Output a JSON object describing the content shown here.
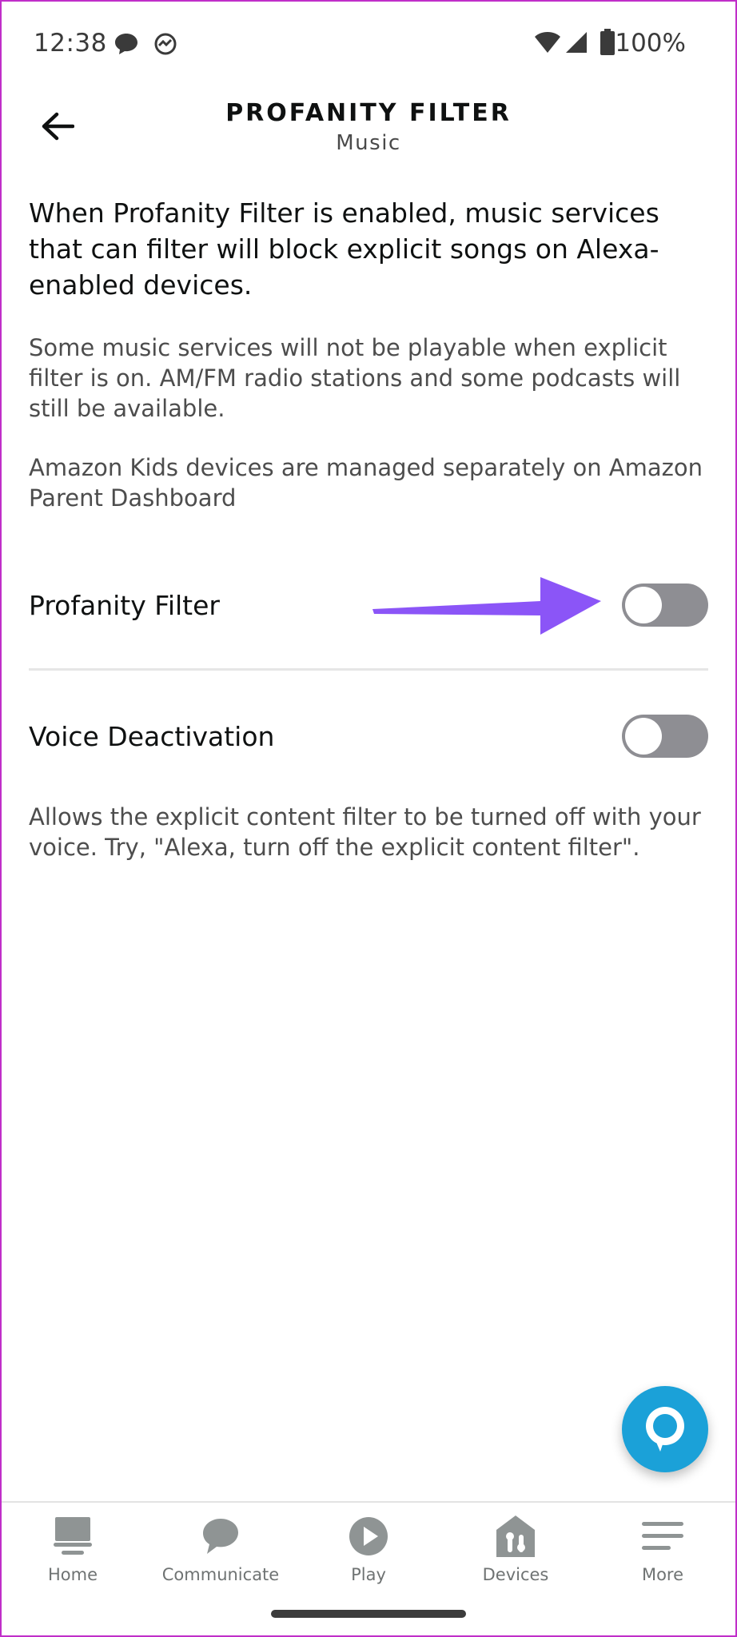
{
  "status_bar": {
    "time": "12:38",
    "battery": "100%",
    "icons": [
      "chat-bubble-icon",
      "activity-icon",
      "wifi-icon",
      "signal-icon",
      "battery-icon"
    ]
  },
  "header": {
    "title": "PROFANITY FILTER",
    "subtitle": "Music",
    "back_icon": "back-arrow-icon"
  },
  "content": {
    "intro": "When Profanity Filter is enabled, music services that can filter will block explicit songs on Alexa-enabled devices.",
    "note_1": "Some music services will not be playable when explicit filter is on. AM/FM radio stations and some podcasts will still be available.",
    "note_2": "Amazon Kids devices are managed separately on Amazon Parent Dashboard",
    "settings": [
      {
        "label": "Profanity Filter",
        "enabled": false
      },
      {
        "label": "Voice Deactivation",
        "enabled": false
      }
    ],
    "voice_help": "Allows the explicit content filter to be turned off with your voice. Try, \"Alexa, turn off the explicit content filter\"."
  },
  "annotation": {
    "color": "#8b55f7",
    "icon": "arrow-right-icon"
  },
  "alexa_button": {
    "icon": "alexa-icon",
    "color": "#1ba1d8"
  },
  "bottom_nav": {
    "items": [
      {
        "label": "Home",
        "icon": "home-icon"
      },
      {
        "label": "Communicate",
        "icon": "communicate-icon"
      },
      {
        "label": "Play",
        "icon": "play-icon"
      },
      {
        "label": "Devices",
        "icon": "devices-icon"
      },
      {
        "label": "More",
        "icon": "menu-icon"
      }
    ]
  },
  "colors": {
    "toggle_off": "#8e8e93",
    "nav_icon": "#8f9494",
    "text_primary": "#0f1111",
    "text_secondary": "#4d4d4d"
  }
}
